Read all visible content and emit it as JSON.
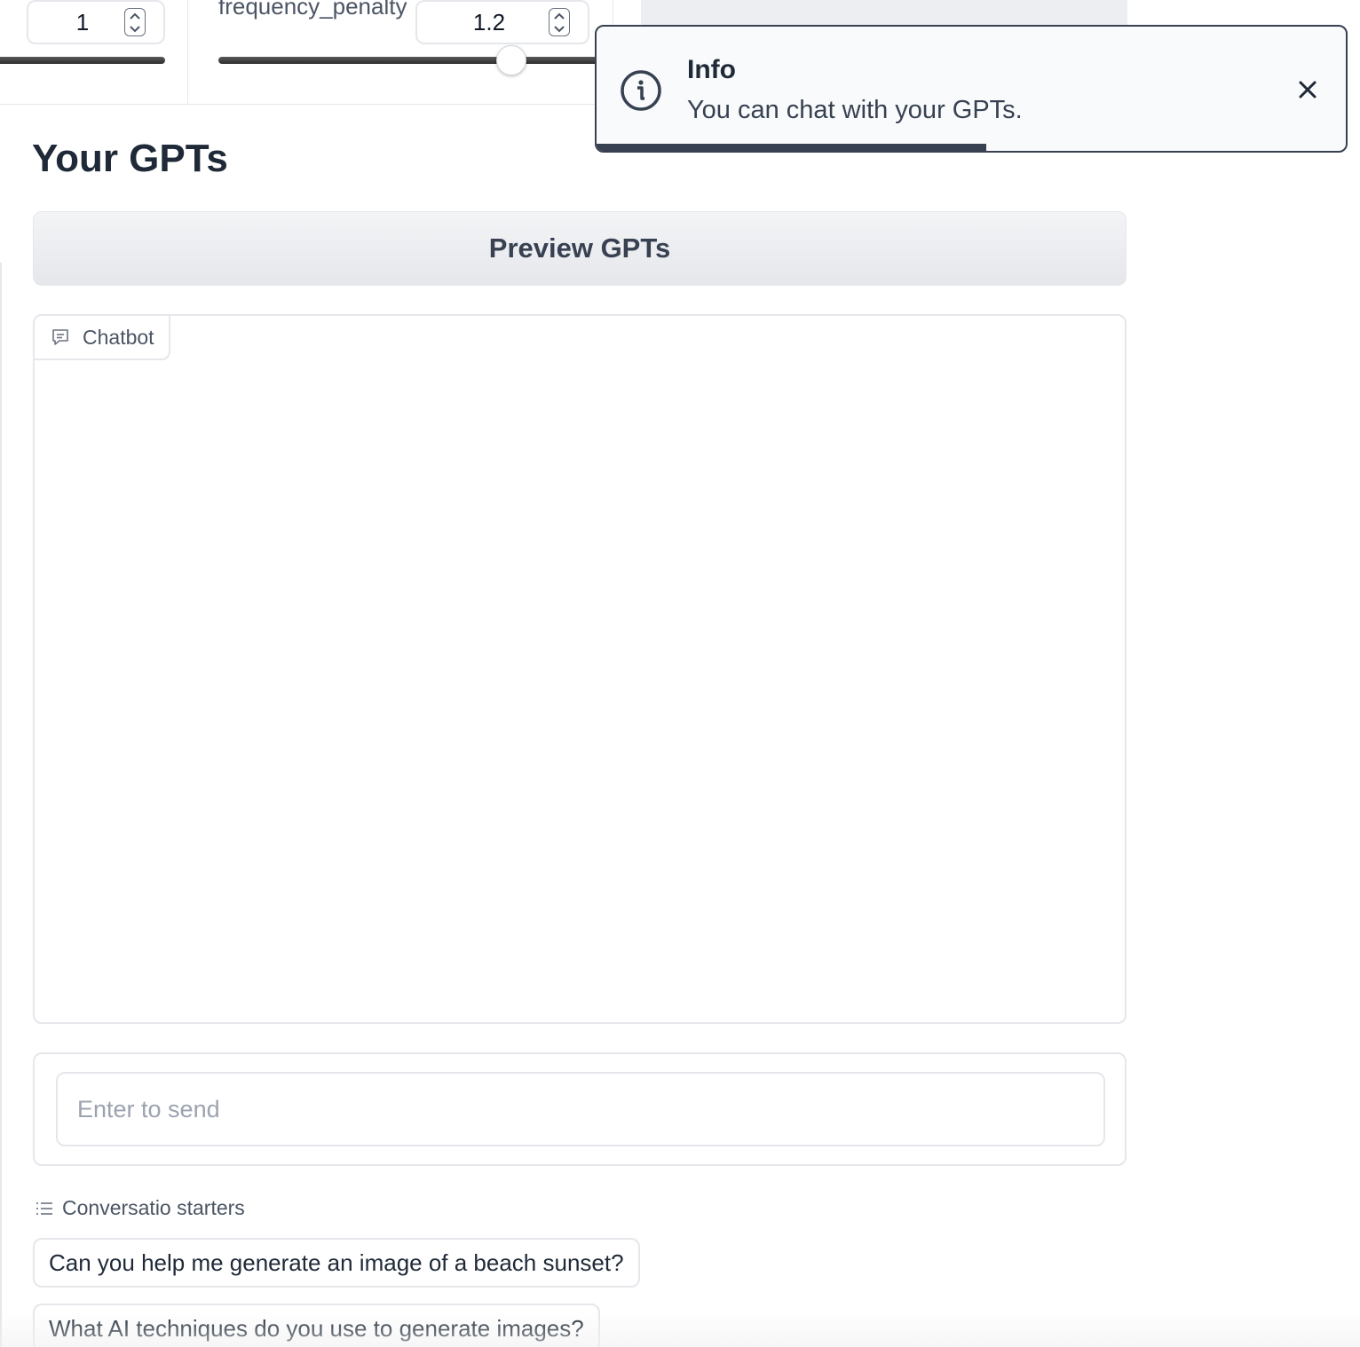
{
  "params": {
    "first_value": "1",
    "second_label": "frequency_penalty",
    "second_value": "1.2",
    "second_slider_fraction": 0.77
  },
  "toast": {
    "title": "Info",
    "message": "You can chat with your GPTs.",
    "progress_fraction": 0.52
  },
  "main": {
    "section_title": "Your GPTs",
    "preview_button": "Preview GPTs",
    "chatbot_label": "Chatbot",
    "input_placeholder": "Enter to send",
    "starters_label": "Conversatio starters",
    "starters": [
      "Can you help me generate an image of a beach sunset?",
      "What AI techniques do you use to generate images?"
    ]
  },
  "colors": {
    "accent_dark": "#374151",
    "border": "#e5e7eb",
    "button_bg": "#eceef1"
  }
}
